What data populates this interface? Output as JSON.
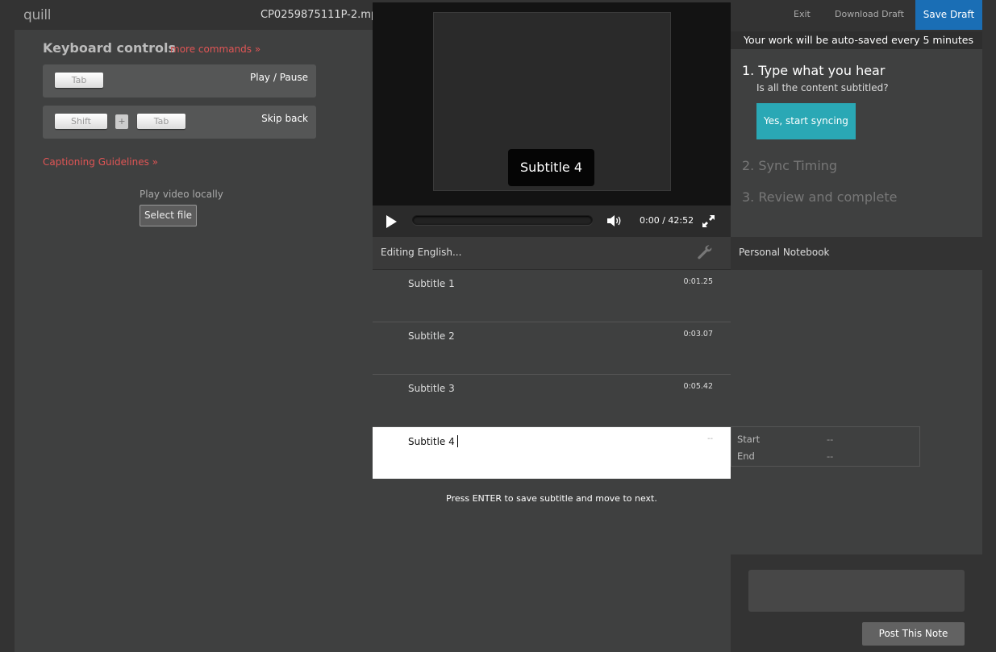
{
  "app": {
    "logo": "quill",
    "filename": "CP0259875111P-2.mp"
  },
  "header": {
    "exit": "Exit",
    "download_draft": "Download Draft",
    "save_draft": "Save Draft"
  },
  "autosave_notice": "Your work will be auto-saved every 5 minutes",
  "keyboard": {
    "title": "Keyboard controls",
    "more_commands": "more commands »",
    "shortcuts": [
      {
        "keys": [
          "Tab"
        ],
        "action": "Play / Pause"
      },
      {
        "keys": [
          "Shift",
          "Tab"
        ],
        "joiner": "+",
        "action": "Skip back"
      }
    ]
  },
  "guidelines_link": "Captioning Guidelines »",
  "local_video": {
    "label": "Play video locally",
    "button": "Select file"
  },
  "video": {
    "overlay_subtitle": "Subtitle 4",
    "time_display": "0:00 / 42:52",
    "progress": 0
  },
  "editor": {
    "label": "Editing English...",
    "subtitles": [
      {
        "text": "Subtitle 1",
        "time": "0:01.25"
      },
      {
        "text": "Subtitle 2",
        "time": "0:03.07"
      },
      {
        "text": "Subtitle 3",
        "time": "0:05.42"
      },
      {
        "text": "Subtitle 4",
        "time": "--"
      }
    ],
    "hint": "Press ENTER to save subtitle and move to next."
  },
  "steps": {
    "step1": "1. Type what you hear",
    "step1_question": "Is all the content subtitled?",
    "step1_button": "Yes, start syncing",
    "step2": "2. Sync Timing",
    "step3": "3. Review and complete"
  },
  "notebook": {
    "title": "Personal Notebook",
    "timing": {
      "start_label": "Start",
      "start_value": "--",
      "end_label": "End",
      "end_value": "--"
    },
    "post_button": "Post This Note"
  },
  "colors": {
    "save_draft": "#1a6eb5",
    "sync_button": "#2aa8b5",
    "links": "#e05555",
    "background": "#333333"
  }
}
